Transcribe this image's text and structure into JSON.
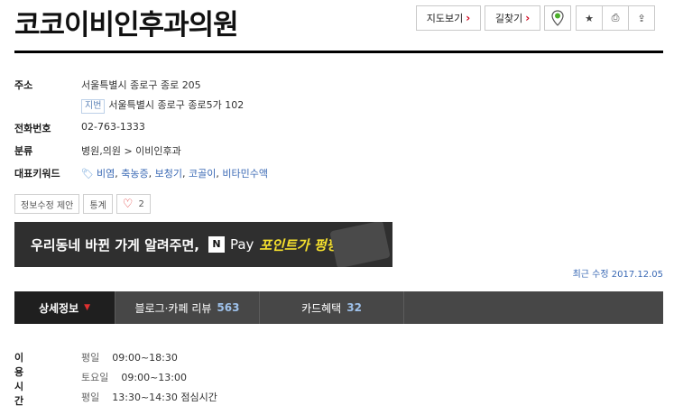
{
  "page_title": "코코이비인후과의원",
  "toolbar": {
    "map_label": "지도보기",
    "route_label": "길찾기",
    "arrow": "›",
    "star_icon": "★",
    "print_icon": "⎙",
    "share_icon": "⇪"
  },
  "info": {
    "address_label": "주소",
    "address": "서울특별시 종로구 종로 205",
    "lot_badge": "지번",
    "lot_address": "서울특별시 종로구 종로5가 102",
    "phone_label": "전화번호",
    "phone": "02-763-1333",
    "category_label": "분류",
    "category": "병원,의원 > 이비인후과",
    "keywords_label": "대표키워드",
    "keywords": [
      "비염",
      "축농증",
      "보청기",
      "코골이",
      "비타민수액"
    ]
  },
  "actions": {
    "suggest_edit": "정보수정 제안",
    "stats": "통계",
    "like_count": "2"
  },
  "banner": {
    "text": "우리동네 바뀐 가게 알려주면,",
    "n": "N",
    "pay": "Pay",
    "point": "포인트가 펑펑!"
  },
  "last_updated": "최근 수정 2017.12.05",
  "tabs": [
    {
      "label": "상세정보",
      "count": ""
    },
    {
      "label": "블로그·카페 리뷰",
      "count": "563"
    },
    {
      "label": "카드혜택",
      "count": "32"
    }
  ],
  "hours": {
    "label": "이용시간",
    "entries": [
      {
        "day": "평일",
        "time": "09:00~18:30"
      },
      {
        "day": "토요일",
        "time": "09:00~13:00"
      },
      {
        "day": "평일",
        "time": "13:30~14:30 점심시간"
      }
    ]
  },
  "colors": {
    "accent": "#d0021b",
    "link": "#3b6ab5",
    "tab_bg": "#474747",
    "banner_bg": "#2f2f2f"
  }
}
